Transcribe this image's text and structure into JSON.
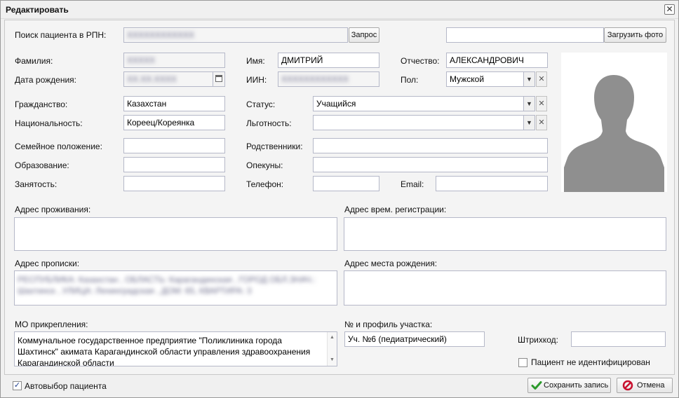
{
  "window": {
    "title": "Редактировать"
  },
  "search": {
    "label": "Поиск пациента в РПН:",
    "value": "XXXXXXXXXXXX",
    "request_button": "Запрос",
    "photo_path_value": "",
    "upload_photo_button": "Загрузить фото"
  },
  "person": {
    "surname_label": "Фамилия:",
    "surname_value": "XXXXX",
    "name_label": "Имя:",
    "name_value": "ДМИТРИЙ",
    "patronymic_label": "Отчество:",
    "patronymic_value": "АЛЕКСАНДРОВИЧ",
    "birthdate_label": "Дата рождения:",
    "birthdate_value": "XX.XX.XXXX",
    "iin_label": "ИИН:",
    "iin_value": "XXXXXXXXXXXX",
    "gender_label": "Пол:",
    "gender_value": "Мужской"
  },
  "details": {
    "citizenship_label": "Гражданство:",
    "citizenship_value": "Казахстан",
    "status_label": "Статус:",
    "status_value": "Учащийся",
    "nationality_label": "Национальность:",
    "nationality_value": "Кореец/Кореянка",
    "benefit_label": "Льготность:",
    "benefit_value": "",
    "marital_label": "Семейное положение:",
    "marital_value": "",
    "relatives_label": "Родственники:",
    "relatives_value": "",
    "education_label": "Образование:",
    "education_value": "",
    "guardians_label": "Опекуны:",
    "guardians_value": "",
    "employment_label": "Занятость:",
    "employment_value": "",
    "phone_label": "Телефон:",
    "phone_value": "",
    "email_label": "Email:",
    "email_value": ""
  },
  "addresses": {
    "residence_label": "Адрес проживания:",
    "residence_value": "",
    "temp_reg_label": "Адрес врем. регистрации:",
    "temp_reg_value": "",
    "registration_label": "Адрес прописки:",
    "registration_value": "РЕСПУБЛИКА: Казахстан , ОБЛАСТЬ: Карагандинская , ГОРОД ОБЛ.ЗНАЧ.: Шахтинск , УЛИЦА: Ленинградская , ДОМ: 65, КВАРТИРА: 3",
    "birthplace_label": "Адрес места рождения:",
    "birthplace_value": ""
  },
  "attachment": {
    "mo_label": "МО прикрепления:",
    "mo_value": "Коммунальное государственное предприятие \"Поликлиника города Шахтинск\" акимата Карагандинской области управления здравоохранения Карагандинской области",
    "district_label": "№ и профиль участка:",
    "district_value": "Уч. №6 (педиатрический)",
    "barcode_label": "Штрихкод:",
    "barcode_value": "",
    "unidentified_label": "Пациент не идентифицирован",
    "unidentified_checked": false
  },
  "footer": {
    "autoselect_label": "Автовыбор пациента",
    "autoselect_checked": true,
    "save_button": "Сохранить запись",
    "cancel_button": "Отмена"
  },
  "icons": {
    "close": "close-icon",
    "calendar": "calendar-icon",
    "dropdown": "chevron-down-icon",
    "clear": "clear-icon",
    "save": "check-icon",
    "cancel": "cancel-icon",
    "avatar": "person-silhouette-icon"
  },
  "colors": {
    "save_check": "#2c9a2c",
    "cancel_red": "#c8102e",
    "avatar_gray": "#8f8f8f"
  }
}
